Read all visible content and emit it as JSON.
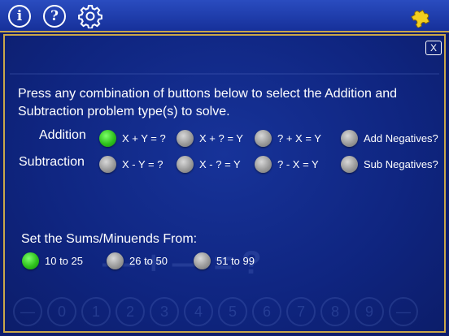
{
  "toolbar": {
    "info_label": "i",
    "help_label": "?"
  },
  "dialog": {
    "close_label": "X",
    "instructions": "Press any combination of buttons below to select the Addition and Subtraction problem type(s) to solve."
  },
  "addition": {
    "label": "Addition",
    "options": [
      {
        "label": "X + Y = ?",
        "selected": true
      },
      {
        "label": "X + ? = Y",
        "selected": false
      },
      {
        "label": "? + X = Y",
        "selected": false
      },
      {
        "label": "Add Negatives?",
        "selected": false
      }
    ]
  },
  "subtraction": {
    "label": "Subtraction",
    "options": [
      {
        "label": "X - Y = ?",
        "selected": false
      },
      {
        "label": "X - ? = Y",
        "selected": false
      },
      {
        "label": "? - X = Y",
        "selected": false
      },
      {
        "label": "Sub Negatives?",
        "selected": false
      }
    ]
  },
  "range": {
    "title": "Set the Sums/Minuends From:",
    "options": [
      {
        "label": "10 to 25",
        "selected": true
      },
      {
        "label": "26 to 50",
        "selected": false
      },
      {
        "label": "51 to 99",
        "selected": false
      }
    ]
  },
  "colors": {
    "background": "#0d1d6e",
    "border_gold": "#c9a64a",
    "selected_green": "#2ec11c",
    "unselected_gray": "#9a9a9a"
  },
  "icons": [
    "info-icon",
    "help-icon",
    "gear-icon",
    "puzzle-icon",
    "close-icon"
  ]
}
